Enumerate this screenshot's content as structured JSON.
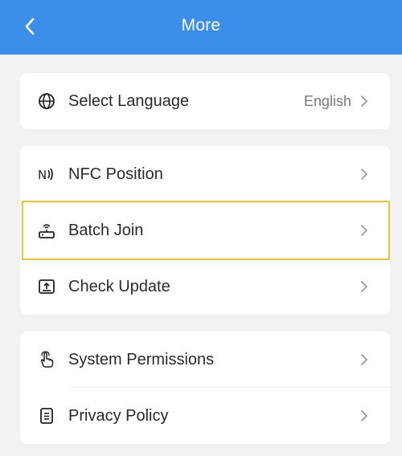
{
  "header": {
    "title": "More",
    "background": "#3b8fe8",
    "back_icon": "chevron-left-icon"
  },
  "sections": [
    {
      "items": [
        {
          "label": "Select Language",
          "value": "English",
          "icon": "globe-icon"
        }
      ]
    },
    {
      "items": [
        {
          "label": "NFC Position",
          "icon": "nfc-icon"
        },
        {
          "label": "Batch Join",
          "icon": "router-wifi-icon",
          "highlighted": true
        },
        {
          "label": "Check Update",
          "icon": "upload-icon"
        }
      ]
    },
    {
      "items": [
        {
          "label": "System Permissions",
          "icon": "hand-pointer-icon"
        },
        {
          "label": "Privacy Policy",
          "icon": "document-list-icon"
        }
      ]
    }
  ],
  "accent_highlight": "#f0c23a"
}
